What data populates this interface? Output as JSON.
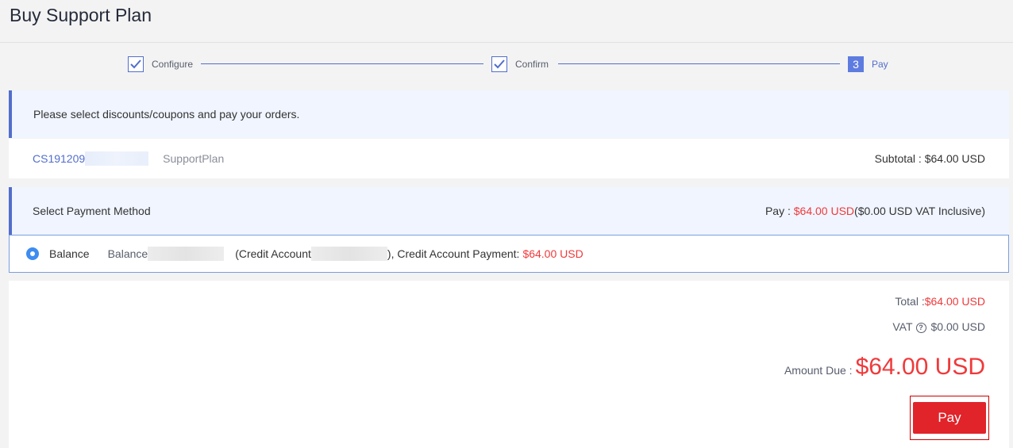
{
  "page": {
    "title": "Buy Support Plan"
  },
  "steps": [
    {
      "label": "Configure",
      "state": "done"
    },
    {
      "label": "Confirm",
      "state": "done"
    },
    {
      "label": "Pay",
      "number": "3",
      "state": "active"
    }
  ],
  "notice": {
    "text": "Please select discounts/coupons and pay your orders."
  },
  "order": {
    "id_prefix": "CS191209",
    "type": "SupportPlan",
    "subtotal_label": "Subtotal : ",
    "subtotal_value": "$64.00 USD"
  },
  "payment_method": {
    "header": "Select Payment Method",
    "pay_label": "Pay : ",
    "pay_amount": "$64.00 USD",
    "vat_note": "($0.00 USD VAT Inclusive)",
    "option": {
      "label": "Balance",
      "balance_prefix": "Balance",
      "credit_prefix": "(Credit Account",
      "credit_suffix": "), Credit Account Payment: ",
      "credit_amount": "$64.00 USD"
    }
  },
  "summary": {
    "total_label": "Total :",
    "total_value": "$64.00 USD",
    "vat_label": "VAT",
    "vat_value": "$0.00 USD",
    "amount_due_label": "Amount Due :",
    "amount_due_value": "$64.00 USD"
  },
  "actions": {
    "pay_label": "Pay"
  },
  "colors": {
    "accent": "#526ecc",
    "price_red": "#f0393b",
    "pay_button": "#e1232a"
  }
}
